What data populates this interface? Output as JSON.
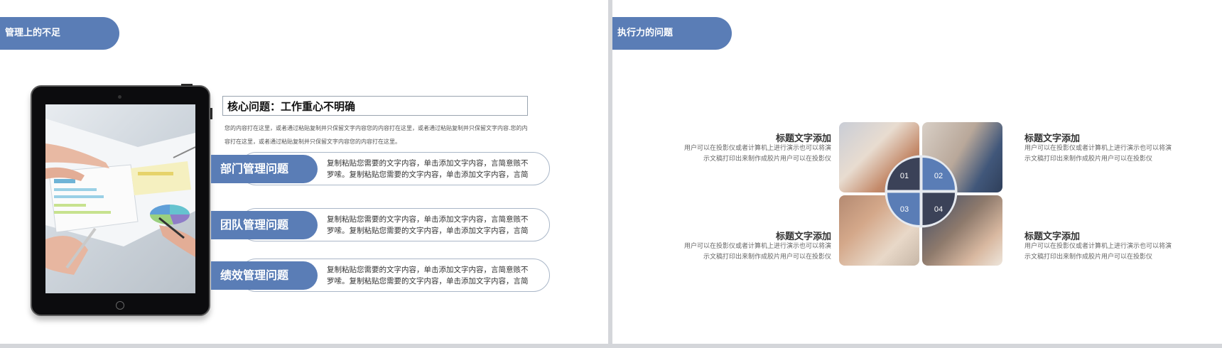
{
  "left_slide": {
    "title": "管理上的不足",
    "core": {
      "heading": "核心问题：工作重心不明确",
      "desc_line1": "您的内容打在这里，或者通过粘贴复制并只保留文字内容您的内容打在这里，或者通过粘贴复制并只保留文字内容.您的内",
      "desc_line2": "容打在这里，或者通过粘贴复制并只保留文字内容您的内容打在这里。"
    },
    "issues": [
      {
        "label": "部门管理问题",
        "line1": "复制粘贴您需要的文字内容，单击添加文字内容，言简意赅不",
        "line2": "罗嗦。复制粘贴您需要的文字内容，单击添加文字内容，言简"
      },
      {
        "label": "团队管理问题",
        "line1": "复制粘贴您需要的文字内容，单击添加文字内容，言简意赅不",
        "line2": "罗嗦。复制粘贴您需要的文字内容，单击添加文字内容，言简"
      },
      {
        "label": "绩效管理问题",
        "line1": "复制粘贴您需要的文字内容，单击添加文字内容，言简意赅不",
        "line2": "罗嗦。复制粘贴您需要的文字内容，单击添加文字内容，言简"
      }
    ]
  },
  "right_slide": {
    "title": "执行力的问题",
    "segments": [
      "01",
      "02",
      "03",
      "04"
    ],
    "items": [
      {
        "title": "标题文字添加",
        "line1": "用户可以在投影仪或者计算机上进行演示也可以将演",
        "line2": "示文稿打印出来制作成胶片用户可以在投影仪"
      },
      {
        "title": "标题文字添加",
        "line1": "用户可以在投影仪或者计算机上进行演示也可以将演",
        "line2": "示文稿打印出来制作成胶片用户可以在投影仪"
      },
      {
        "title": "标题文字添加",
        "line1": "用户可以在投影仪或者计算机上进行演示也可以将演",
        "line2": "示文稿打印出来制作成胶片用户可以在投影仪"
      },
      {
        "title": "标题文字添加",
        "line1": "用户可以在投影仪或者计算机上进行演示也可以将演",
        "line2": "示文稿打印出来制作成胶片用户可以在投影仪"
      }
    ]
  },
  "colors": {
    "accent": "#5a7db6",
    "dark_segment": "#3b4258",
    "outline": "#aab7c8"
  }
}
